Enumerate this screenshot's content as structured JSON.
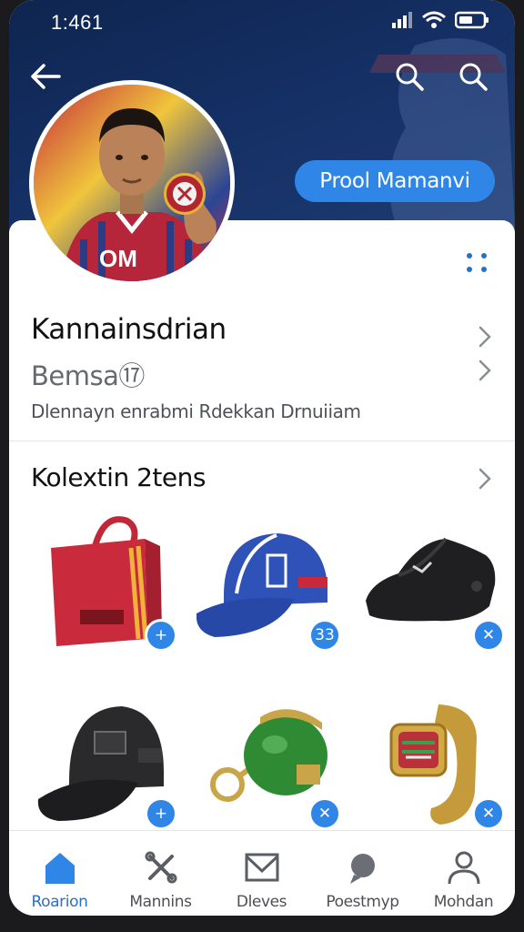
{
  "status_bar": {
    "time": "1:461"
  },
  "header": {
    "back_icon": "arrow-left-icon",
    "search_icons": [
      "search-icon",
      "search-icon"
    ],
    "primary_button_label": "Prool Mamanvi",
    "jersey_text": "OM"
  },
  "profile": {
    "name": "Kannainsdrian",
    "subtitle": "Bemsa⑰",
    "description": "Dlennayn enrabmi Rdekkan Drnuiiam"
  },
  "collection": {
    "title": "Kolextin 2tens",
    "items": [
      {
        "name": "red-tote-bag",
        "badge": "+"
      },
      {
        "name": "blue-cap",
        "badge": "33"
      },
      {
        "name": "black-shoe",
        "badge": "✕"
      },
      {
        "name": "black-cap",
        "badge": "+"
      },
      {
        "name": "green-keychain",
        "badge": "✕"
      },
      {
        "name": "gold-watch",
        "badge": "✕"
      }
    ]
  },
  "bottom_nav": [
    {
      "label": "Roarion",
      "icon": "home-icon",
      "active": true
    },
    {
      "label": "Mannins",
      "icon": "cross-icon",
      "active": false
    },
    {
      "label": "Dleves",
      "icon": "mail-icon",
      "active": false
    },
    {
      "label": "Poestmyp",
      "icon": "chat-icon",
      "active": false
    },
    {
      "label": "Mohdan",
      "icon": "person-icon",
      "active": false
    }
  ],
  "colors": {
    "accent": "#2f86e6",
    "header_dark": "#142f63",
    "active_nav": "#2a6fca"
  }
}
